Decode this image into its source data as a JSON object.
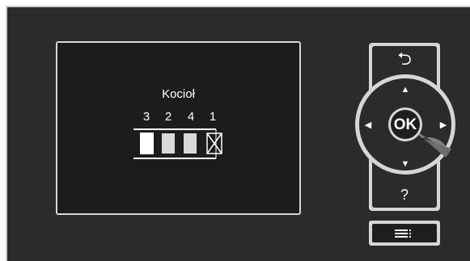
{
  "screen": {
    "title": "Kocioł",
    "slots": [
      {
        "label": "3",
        "state": "filled"
      },
      {
        "label": "2",
        "state": "grey"
      },
      {
        "label": "4",
        "state": "grey"
      },
      {
        "label": "1",
        "state": "crossed"
      }
    ]
  },
  "controls": {
    "back_icon": "back-arrow-icon",
    "back_glyph": "⮌",
    "ok_label": "OK",
    "up_glyph": "▲",
    "down_glyph": "▼",
    "left_glyph": "◀",
    "right_glyph": "▶",
    "help_label": "?",
    "menu_icon": "menu-list-icon"
  },
  "colors": {
    "panel": "#2b2b2b",
    "frame": "#d6d6d6",
    "slot_filled": "#ffffff",
    "slot_grey": "#d9d9d9"
  }
}
